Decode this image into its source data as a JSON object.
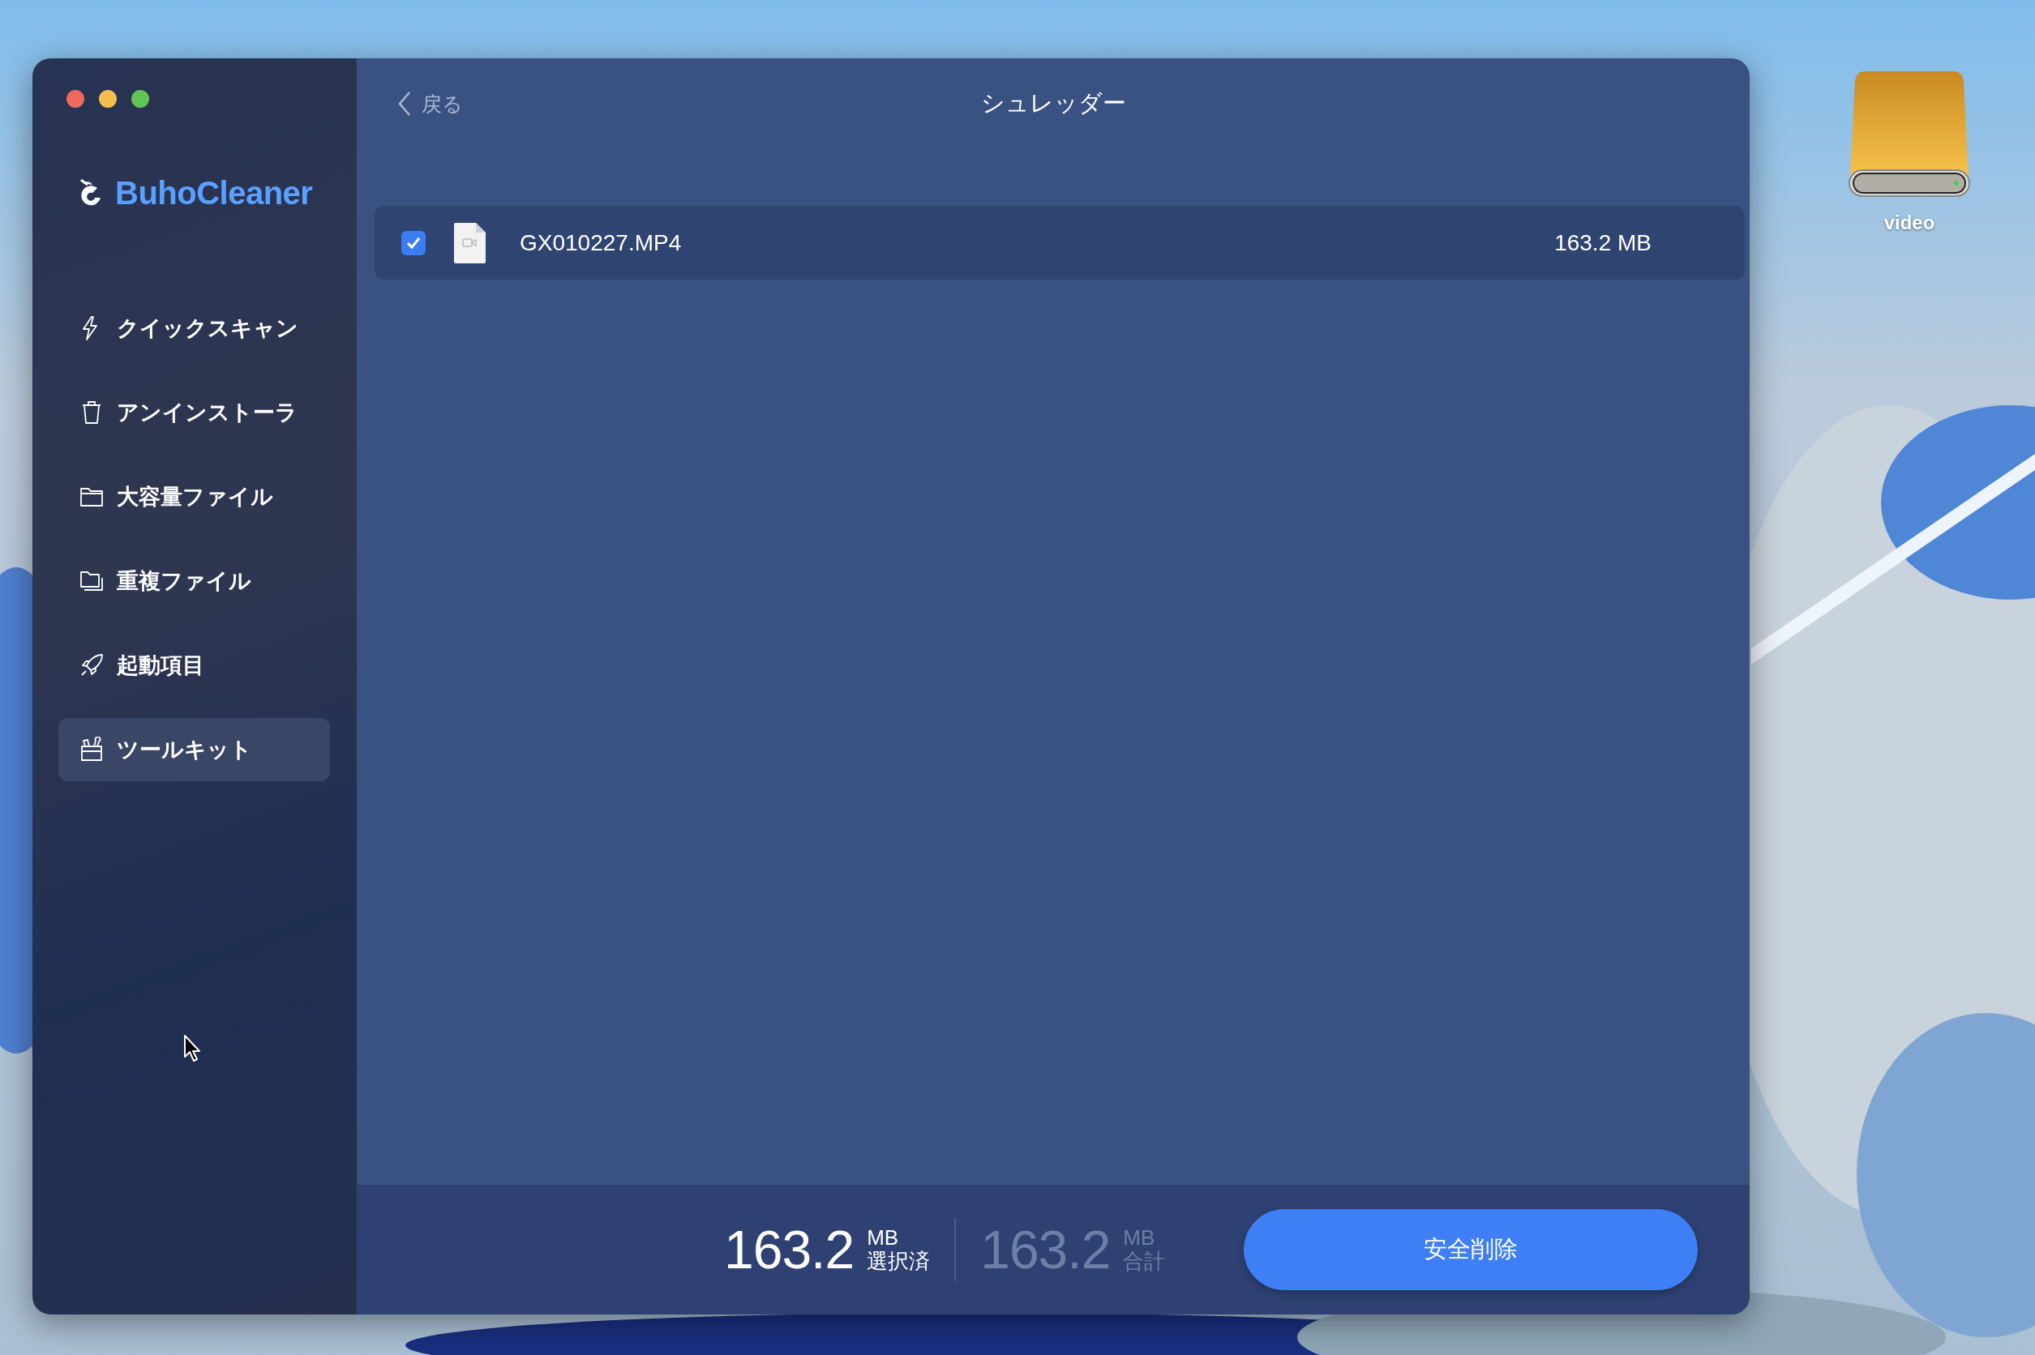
{
  "app": {
    "name": "BuhoCleaner"
  },
  "sidebar": {
    "items": [
      {
        "label": "クイックスキャン",
        "selected": false
      },
      {
        "label": "アンインストーラ",
        "selected": false
      },
      {
        "label": "大容量ファイル",
        "selected": false
      },
      {
        "label": "重複ファイル",
        "selected": false
      },
      {
        "label": "起動項目",
        "selected": false
      },
      {
        "label": "ツールキット",
        "selected": true
      }
    ]
  },
  "header": {
    "back": "戻る",
    "title": "シュレッダー"
  },
  "files": [
    {
      "name": "GX010227.MP4",
      "size": "163.2 MB",
      "checked": true
    }
  ],
  "summary": {
    "selected_value": "163.2",
    "selected_unit": "MB",
    "selected_label": "選択済",
    "total_value": "163.2",
    "total_unit": "MB",
    "total_label": "合計",
    "button": "安全削除"
  },
  "desktop": {
    "icons": [
      {
        "label": "video"
      }
    ]
  }
}
